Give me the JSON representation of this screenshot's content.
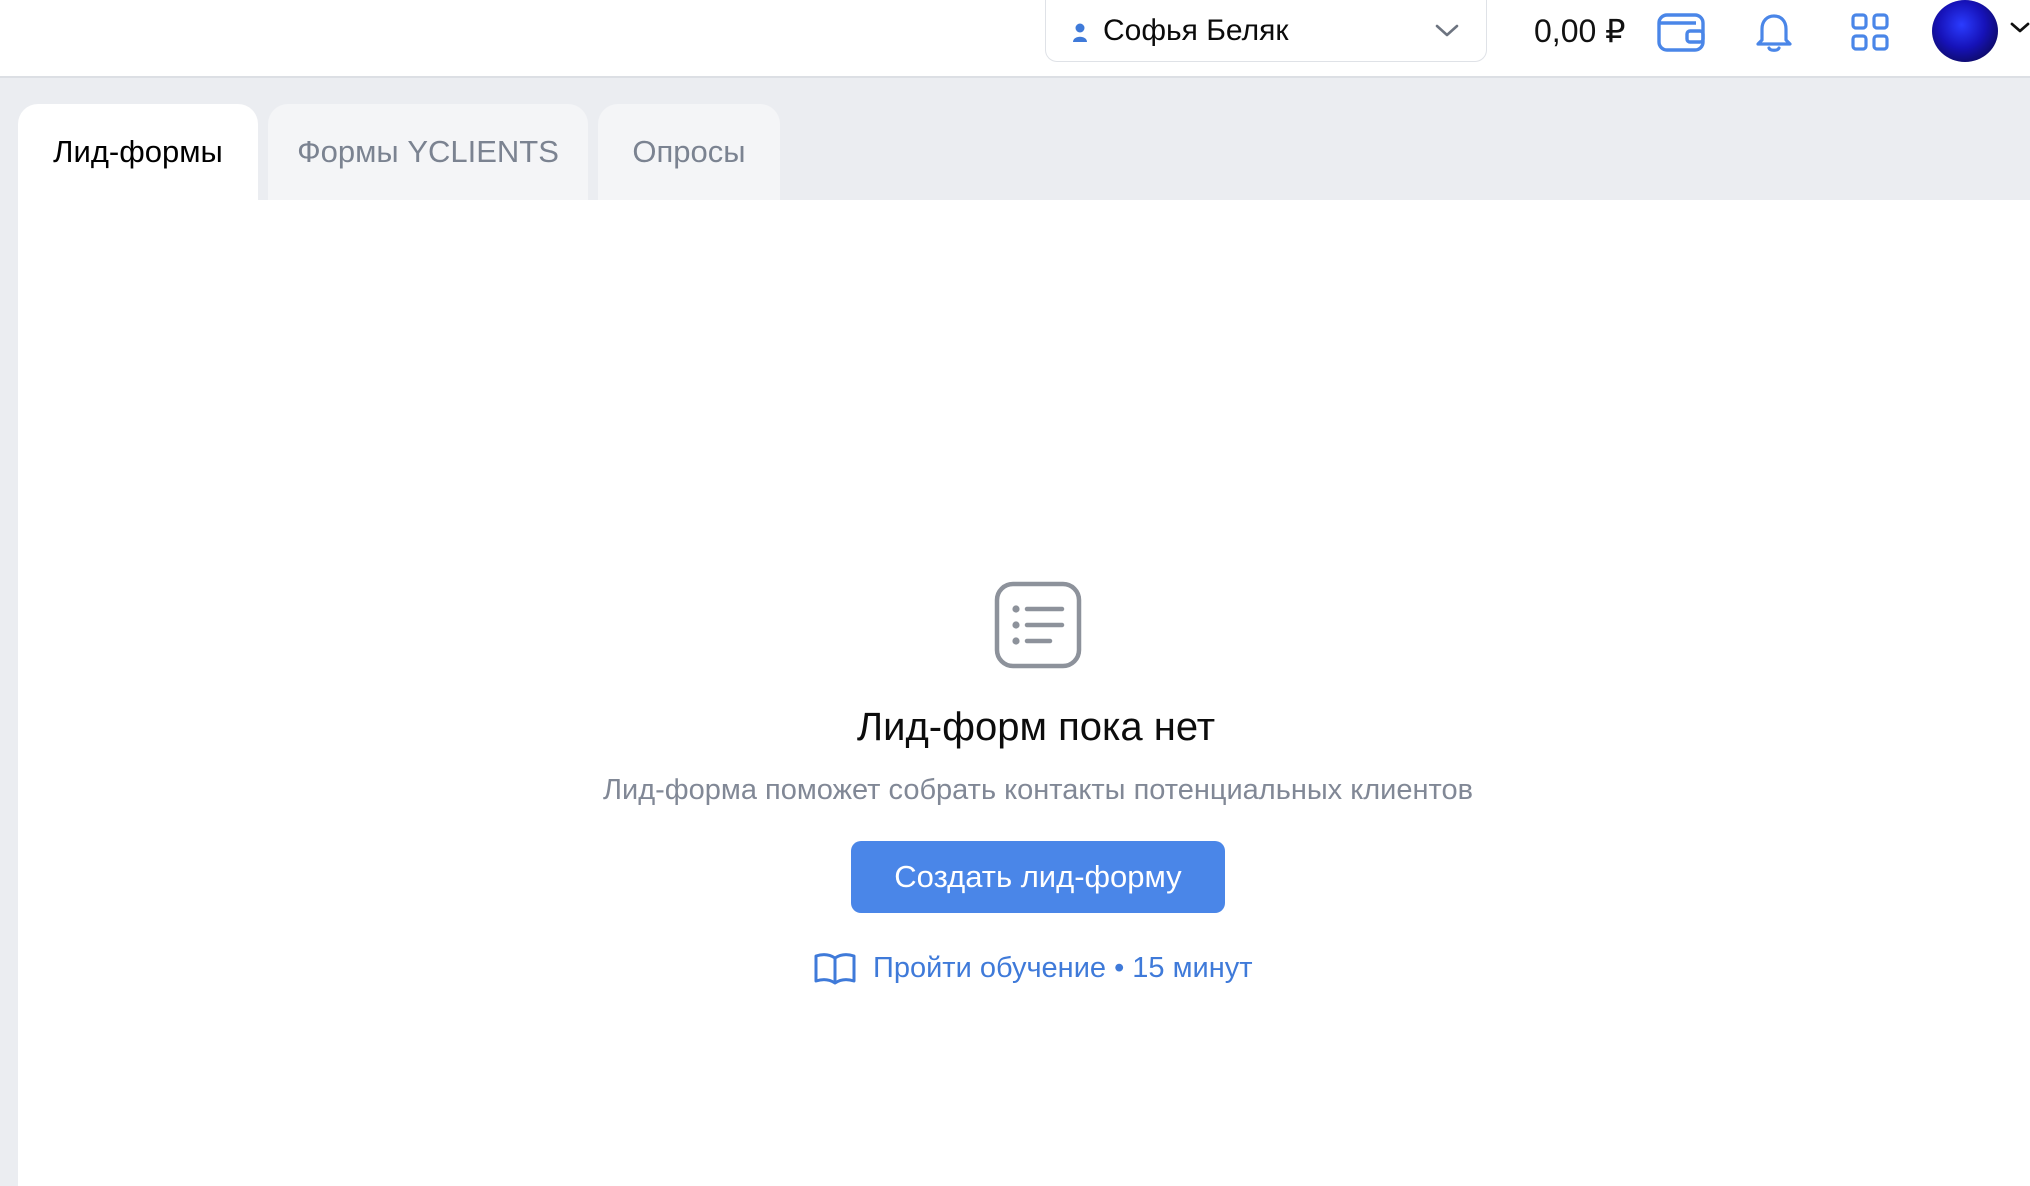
{
  "header": {
    "account_name": "Софья Беляк",
    "balance": "0,00 ₽",
    "icons": [
      "person-icon",
      "chevron-down-icon",
      "wallet-icon",
      "bell-icon",
      "apps-grid-icon",
      "avatar",
      "chevron-down-icon"
    ]
  },
  "tabs": [
    {
      "label": "Лид-формы",
      "active": true
    },
    {
      "label": "Формы YCLIENTS",
      "active": false
    },
    {
      "label": "Опросы",
      "active": false
    }
  ],
  "empty_state": {
    "icon": "list-icon",
    "title": "Лид-форм пока нет",
    "subtitle": "Лид-форма поможет собрать контакты потенциальных клиентов",
    "create_button": "Создать лид-форму",
    "learn_link": "Пройти обучение • 15 минут",
    "learn_icon": "book-icon"
  },
  "colors": {
    "accent": "#4a86e8",
    "link": "#3f7ad9",
    "muted_text": "#818896",
    "page_bg": "#ebedf1"
  }
}
